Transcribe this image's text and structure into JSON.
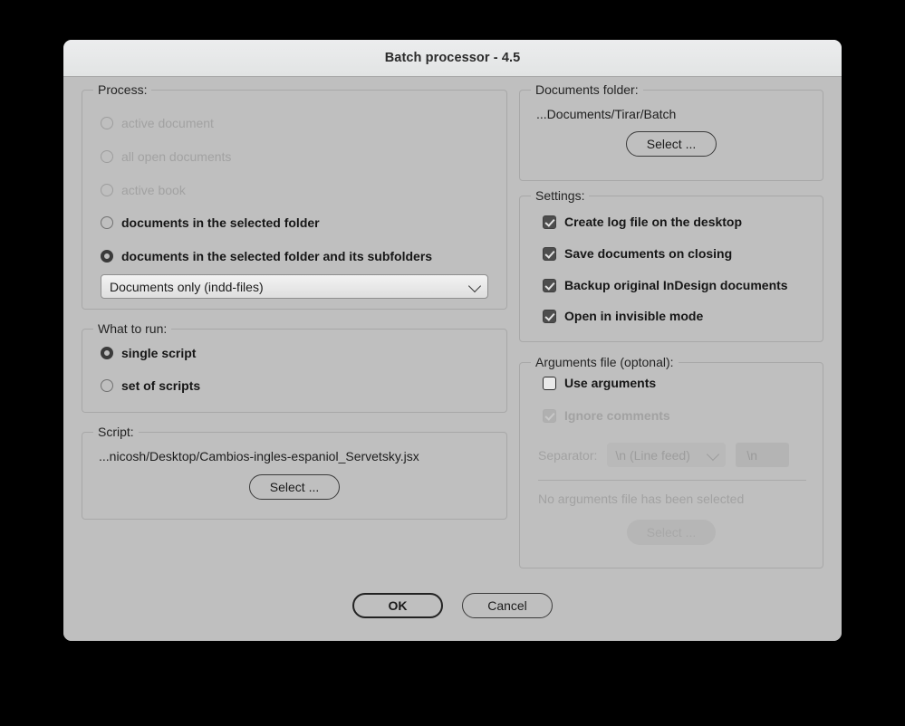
{
  "window": {
    "title": "Batch processor - 4.5"
  },
  "process": {
    "legend": "Process:",
    "options": [
      {
        "label": "active document",
        "selected": false,
        "enabled": false
      },
      {
        "label": "all open documents",
        "selected": false,
        "enabled": false
      },
      {
        "label": "active book",
        "selected": false,
        "enabled": false
      },
      {
        "label": "documents in the selected folder",
        "selected": false,
        "enabled": true
      },
      {
        "label": "documents in the selected folder and its subfolders",
        "selected": true,
        "enabled": true
      }
    ],
    "filter_dropdown": {
      "value": "Documents only (indd-files)",
      "icon": "chevron-down-icon"
    }
  },
  "what_to_run": {
    "legend": "What to run:",
    "options": [
      {
        "label": "single script",
        "selected": true
      },
      {
        "label": "set of scripts",
        "selected": false
      }
    ]
  },
  "script": {
    "legend": "Script:",
    "path": "...nicosh/Desktop/Cambios-ingles-espaniol_Servetsky.jsx",
    "select_label": "Select ..."
  },
  "documents_folder": {
    "legend": "Documents folder:",
    "path": "...Documents/Tirar/Batch",
    "select_label": "Select ..."
  },
  "settings": {
    "legend": "Settings:",
    "items": [
      {
        "label": "Create log file on the desktop",
        "checked": true
      },
      {
        "label": "Save documents on closing",
        "checked": true
      },
      {
        "label": "Backup original InDesign documents",
        "checked": true
      },
      {
        "label": "Open in invisible mode",
        "checked": true
      }
    ]
  },
  "arguments": {
    "legend": "Arguments file (optonal):",
    "use_arguments": {
      "label": "Use arguments",
      "checked": false,
      "enabled": true
    },
    "ignore_comments": {
      "label": "Ignore comments",
      "checked": true,
      "enabled": false
    },
    "separator_label": "Separator:",
    "separator_value": "\\n (Line feed)",
    "separator_custom": "\\n",
    "status": "No arguments file has been selected",
    "select_label": "Select ..."
  },
  "footer": {
    "ok_label": "OK",
    "cancel_label": "Cancel"
  },
  "colors": {
    "window_body": "#bfbfbf",
    "titlebar": "#e8eaea",
    "checkbox_on": "#4d4d4d",
    "text": "#161616",
    "disabled_text": "#a2a2a2"
  }
}
